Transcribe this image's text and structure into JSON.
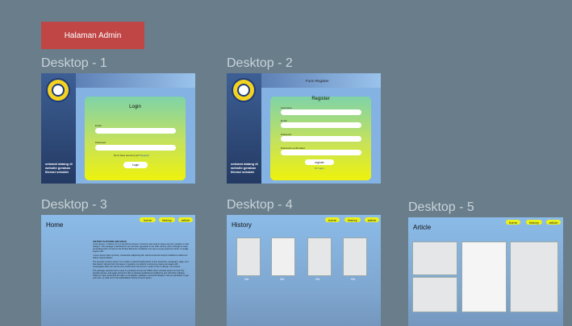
{
  "admin_badge": "Halaman Admin",
  "frames": {
    "d1": {
      "label": "Desktop - 1"
    },
    "d2": {
      "label": "Desktop - 2"
    },
    "d3": {
      "label": "Desktop - 3"
    },
    "d4": {
      "label": "Desktop - 4"
    },
    "d5": {
      "label": "Desktop - 5"
    }
  },
  "tagline": "selamat datang di website gerakan literasi sekolah",
  "login": {
    "title": "Login",
    "email_label": "Email",
    "password_label": "Password",
    "no_account_text": "Don't have account yet?",
    "register_link": "Register",
    "button": "Login"
  },
  "register": {
    "topbar_title": "Form Register",
    "title": "Register",
    "username_label": "Username",
    "email_label": "Email",
    "password_label": "Password",
    "confirm_label": "Password confirmation",
    "button": "register",
    "or_login": "Or Login"
  },
  "nav": {
    "home": "home",
    "history": "history",
    "article": "article"
  },
  "home_page": {
    "title": "Home",
    "heading": "HISTORY PLATFORM AND SPACE",
    "para1": "Lorem ipsum, or lipsum as it is sometimes known, is dummy text used in laying out print, graphic or web designs. The passage is attributed to an unknown typesetter in the 15th century who is thought to have scrambled parts of Cicero's De Finibus Bonorum et Malorum for use in a type specimen book. It usually begins with:",
    "para2": "\"Lorem ipsum dolor sit amet, consectetur adipiscing elit, sed do eiusmod tempor incididunt ut labore et dolore magna aliqua.\"",
    "para3": "The purpose of lorem ipsum is to create a natural looking block of text (sentence, paragraph, page, etc.) that doesn't distract from the layout. A practice not without controversy, laying out pages with meaningless filler text can be very useful when the focus is meant to be on design, not content.",
    "para4": "The passage experienced a surge in popularity during the 1960s when Letraset used it on their dry-transfer sheets, and again during the 90s as desktop publishers bundled the text with their software. Today it's seen all around the web; on templates, websites, and stock designs. Use our generator to get your own, or read on for the authoritative history of lorem ipsum."
  },
  "history_page": {
    "title": "History",
    "captions": [
      "title",
      "title",
      "title",
      "title"
    ]
  },
  "article_page": {
    "title": "Article"
  }
}
